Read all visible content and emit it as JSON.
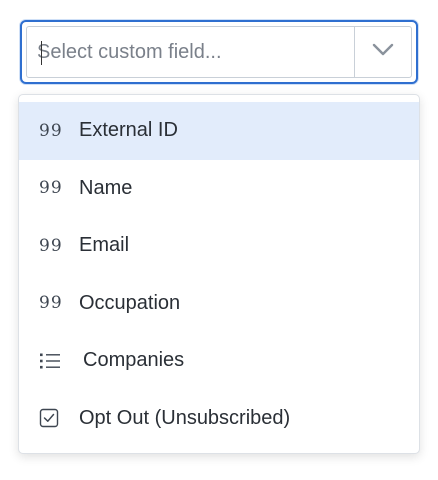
{
  "select": {
    "placeholder": "Select custom field...",
    "value": "",
    "toggle_icon": "chevron-down-icon",
    "accent_color": "#2f6fd0"
  },
  "menu": {
    "options": [
      {
        "label": "External ID",
        "icon": "quote-icon",
        "icon_glyph": "99",
        "highlighted": true
      },
      {
        "label": "Name",
        "icon": "quote-icon",
        "icon_glyph": "99",
        "highlighted": false
      },
      {
        "label": "Email",
        "icon": "quote-icon",
        "icon_glyph": "99",
        "highlighted": false
      },
      {
        "label": "Occupation",
        "icon": "quote-icon",
        "icon_glyph": "99",
        "highlighted": false
      },
      {
        "label": "Companies",
        "icon": "list-icon",
        "highlighted": false
      },
      {
        "label": "Opt Out (Unsubscribed)",
        "icon": "checkbox-icon",
        "highlighted": false
      }
    ],
    "highlight_color": "#e2ecfb"
  }
}
